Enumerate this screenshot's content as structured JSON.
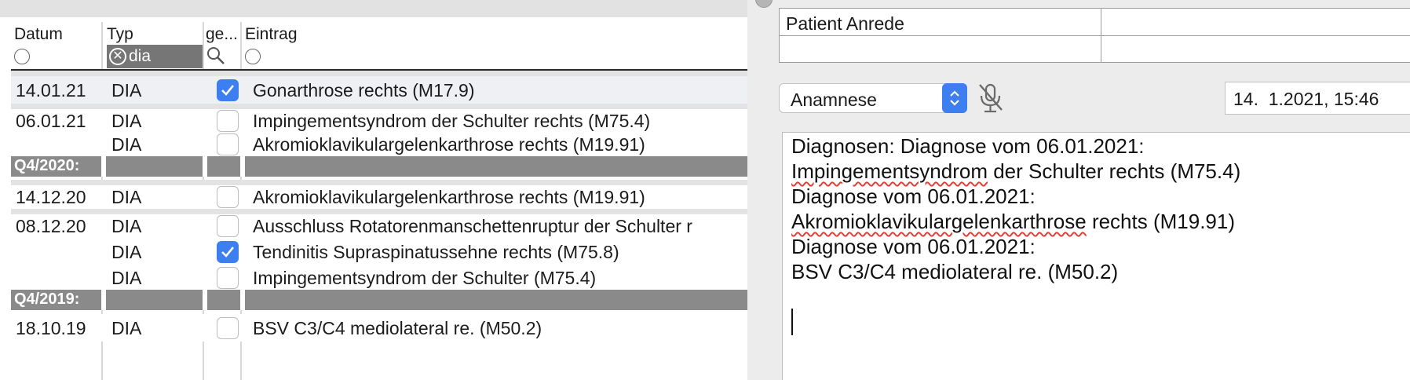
{
  "table": {
    "headers": {
      "date": "Datum",
      "type": "Typ",
      "done": "ge...",
      "entry": "Eintrag"
    },
    "type_filter": "dia",
    "rows": [
      {
        "kind": "entry",
        "date": "14.01.21",
        "type": "DIA",
        "checked": true,
        "entry": "Gonarthrose rechts (M17.9)"
      },
      {
        "kind": "entry",
        "date": "06.01.21",
        "type": "DIA",
        "checked": false,
        "entry": "Impingementsyndrom der Schulter rechts (M75.4)"
      },
      {
        "kind": "entry",
        "date": "",
        "type": "DIA",
        "checked": false,
        "entry": "Akromioklavikulargelenkarthrose rechts (M19.91)"
      },
      {
        "kind": "quarter",
        "label": "Q4/2020:"
      },
      {
        "kind": "entry",
        "date": "14.12.20",
        "type": "DIA",
        "checked": false,
        "entry": "Akromioklavikulargelenkarthrose rechts (M19.91)"
      },
      {
        "kind": "entry",
        "date": "08.12.20",
        "type": "DIA",
        "checked": false,
        "entry": "Ausschluss Rotatorenmanschettenruptur der Schulter r"
      },
      {
        "kind": "entry",
        "date": "",
        "type": "DIA",
        "checked": true,
        "entry": "Tendinitis Supraspinatussehne rechts (M75.8)"
      },
      {
        "kind": "entry",
        "date": "",
        "type": "DIA",
        "checked": false,
        "entry": "Impingementsyndrom der Schulter (M75.4)"
      },
      {
        "kind": "quarter",
        "label": "Q4/2019:"
      },
      {
        "kind": "entry",
        "date": "18.10.19",
        "type": "DIA",
        "checked": false,
        "entry": "BSV C3/C4 mediolateral re. (M50.2)"
      }
    ]
  },
  "patient": {
    "anrede_label": "Patient Anrede"
  },
  "category": {
    "selected": "Anamnese"
  },
  "datetime": {
    "value": "14.  1.2021, 15:46"
  },
  "note": {
    "lines": [
      "Diagnosen: Diagnose vom 06.01.2021:",
      "Impingementsyndrom der Schulter rechts (M75.4)",
      "Diagnose vom 06.01.2021:",
      "Akromioklavikulargelenkarthrose rechts (M19.91)",
      "Diagnose vom 06.01.2021:",
      "BSV C3/C4 mediolateral re. (M50.2)"
    ],
    "misspelled": [
      "Impingementsyndrom",
      "Akromioklavikulargelenkarthrose"
    ]
  },
  "colors": {
    "accent": "#3d7ef0",
    "quarter_bg": "#8a8a8a",
    "spellcheck": "#e0413a"
  }
}
